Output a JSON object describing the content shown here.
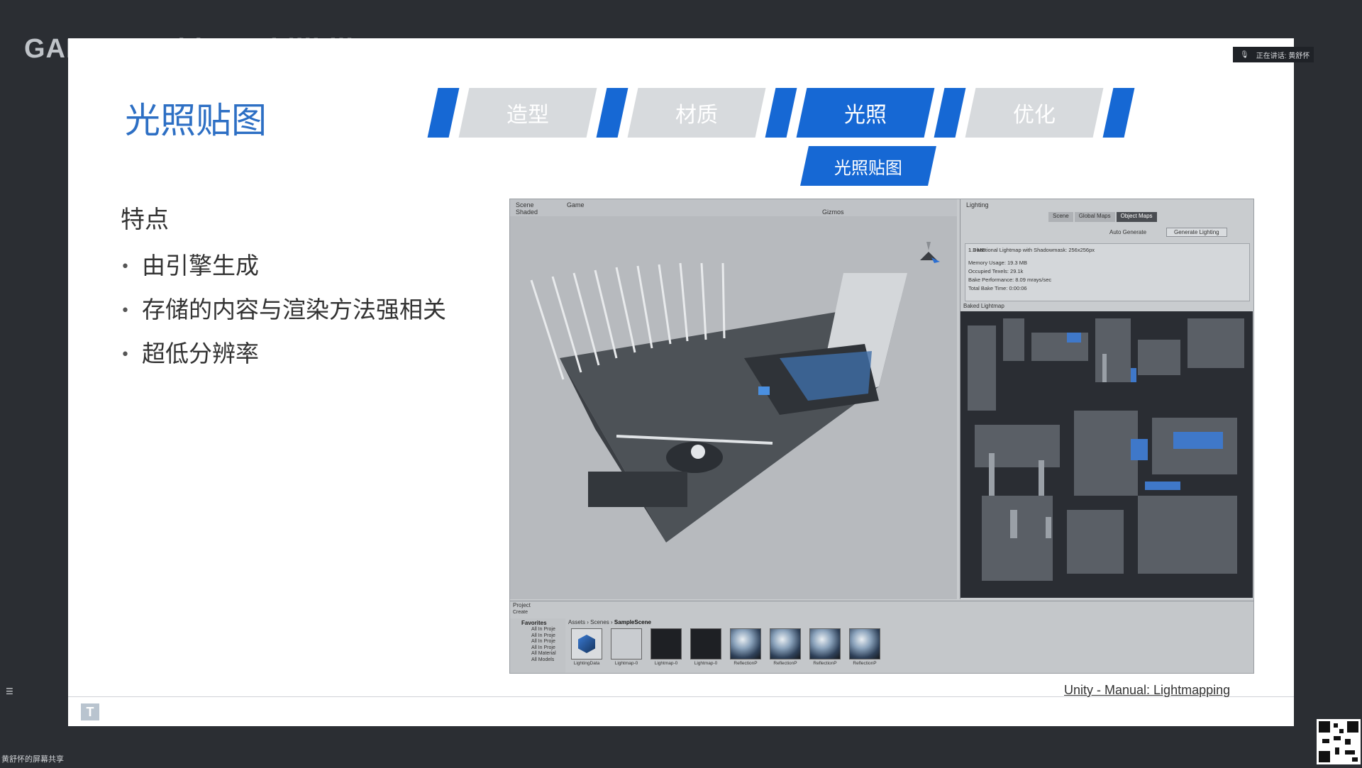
{
  "stream": {
    "overlay_title": "GAMES-Webinar",
    "overlay_site": "bilibili",
    "speaking_label": "正在讲话: 黄舒怀",
    "share_label": "黄舒怀的屏幕共享",
    "menu_glyph": "☰"
  },
  "slide": {
    "title": "光照贴图",
    "nav_tabs": [
      {
        "label": "造型",
        "active": false
      },
      {
        "label": "材质",
        "active": false
      },
      {
        "label": "光照",
        "active": true
      },
      {
        "label": "优化",
        "active": false
      }
    ],
    "sub_tab": "光照贴图",
    "feature_heading": "特点",
    "bullets": [
      "由引擎生成",
      "存储的内容与渲染方法强相关",
      "超低分辨率"
    ],
    "footer_link": "Unity - Manual: Lightmapping",
    "logo_glyph": "T",
    "accent_color": "#1668d4",
    "title_color": "#2d6fc4"
  },
  "unity": {
    "toolbar": {
      "scene_tab": "Scene",
      "game_tab": "Game",
      "shading_mode": "Shaded",
      "gizmos": "Gizmos"
    },
    "lighting": {
      "window_title": "Lighting",
      "tabs": [
        "Scene",
        "Global Maps",
        "Object Maps"
      ],
      "active_tab": "Object Maps",
      "auto_generate": "Auto Generate",
      "generate_button": "Generate Lighting",
      "info_title": "1 Directional Lightmap with Shadowmask: 256x256px",
      "info_size": "1.3 MB",
      "stats": [
        "Memory Usage: 19.3 MB",
        "Occupied Texels: 29.1k",
        "Bake Performance: 8.09 mrays/sec",
        "Total Bake Time: 0:00:06"
      ],
      "lightmap_label": "Baked Lightmap"
    },
    "project": {
      "panel_title": "Project",
      "create_label": "Create",
      "favorites_title": "Favorites",
      "favorites": [
        "All In Proje",
        "All In Proje",
        "All In Proje",
        "All In Proje",
        "All Material",
        "All Models"
      ],
      "breadcrumb": [
        "Assets",
        "Scenes",
        "SampleScene"
      ],
      "assets": [
        {
          "name": "LightingData",
          "kind": "lighting-data-icon"
        },
        {
          "name": "Lightmap-0",
          "kind": "lightmap-icon"
        },
        {
          "name": "Lightmap-0",
          "kind": "lightmap-icon"
        },
        {
          "name": "Lightmap-0",
          "kind": "lightmap-icon"
        },
        {
          "name": "ReflectionP",
          "kind": "reflection-probe-icon"
        },
        {
          "name": "ReflectionP",
          "kind": "reflection-probe-icon"
        },
        {
          "name": "ReflectionP",
          "kind": "reflection-probe-icon"
        },
        {
          "name": "ReflectionP",
          "kind": "reflection-probe-icon"
        }
      ]
    }
  }
}
